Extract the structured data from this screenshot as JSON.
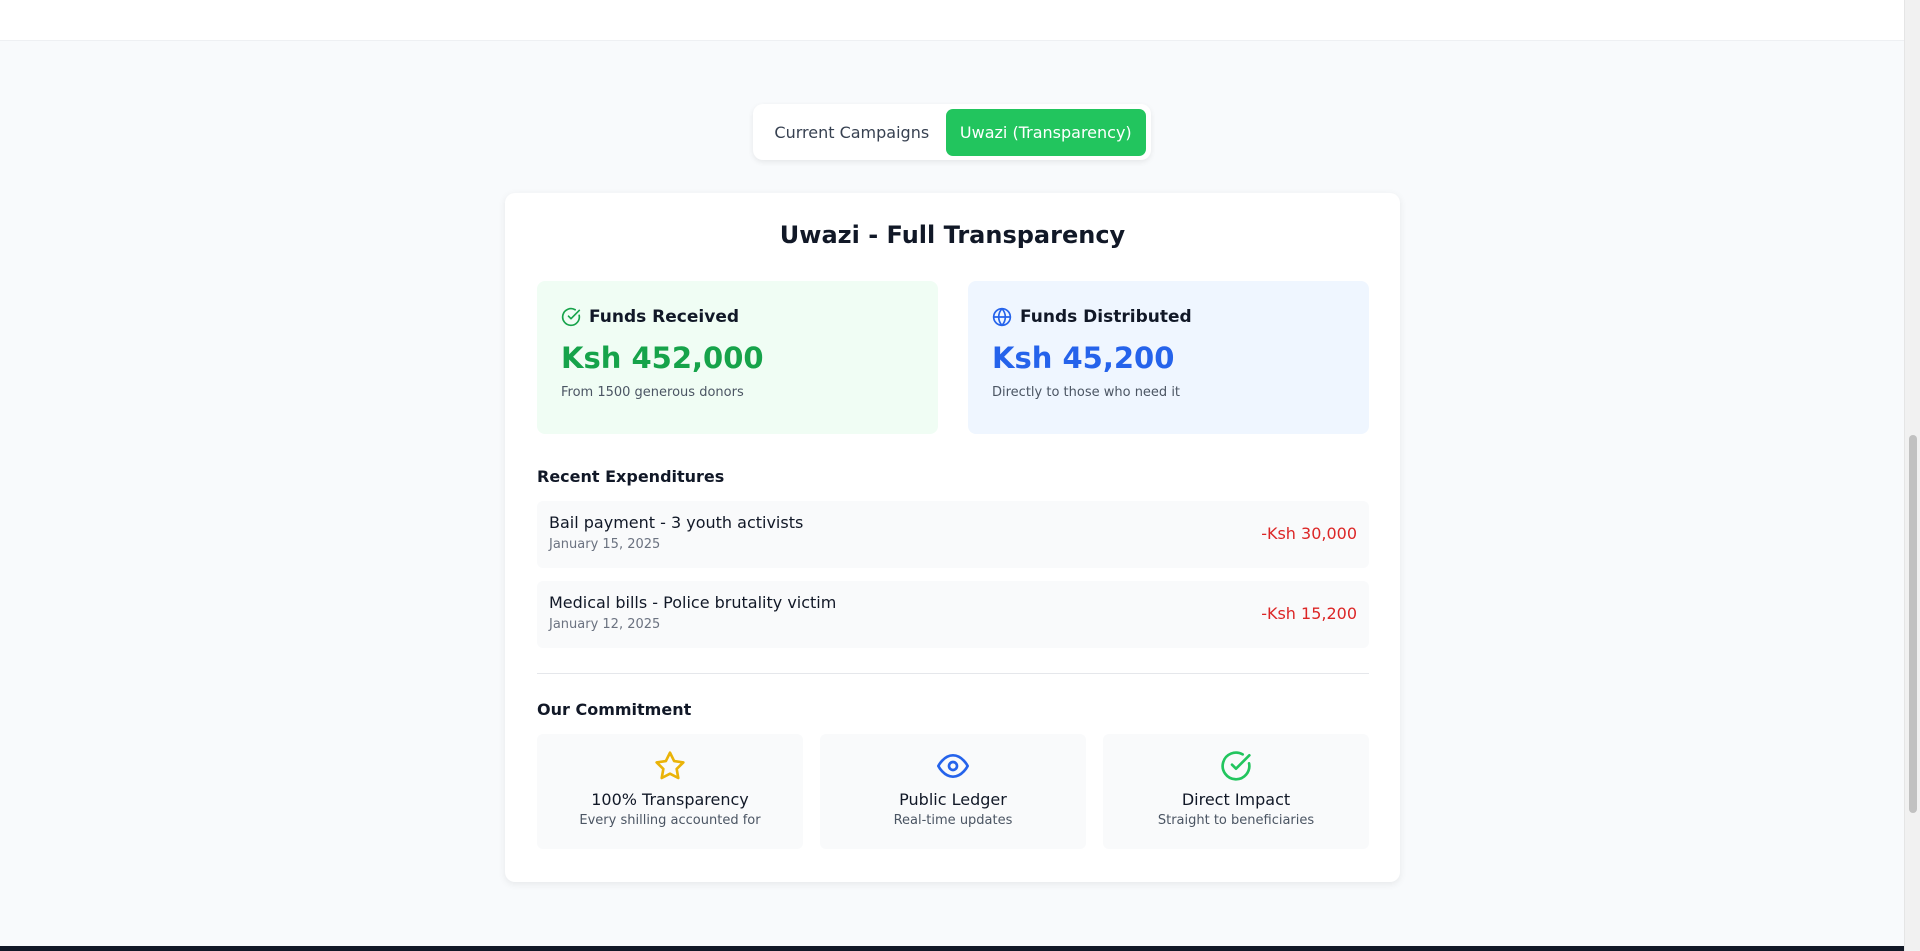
{
  "tabs": {
    "current_campaigns": "Current Campaigns",
    "transparency": "Uwazi (Transparency)"
  },
  "card": {
    "title": "Uwazi - Full Transparency"
  },
  "stats": {
    "received": {
      "label": "Funds Received",
      "amount": "Ksh 452,000",
      "subtitle": "From 1500 generous donors",
      "icon": "check-circle-icon",
      "color": "#16a34a"
    },
    "distributed": {
      "label": "Funds Distributed",
      "amount": "Ksh 45,200",
      "subtitle": "Directly to those who need it",
      "icon": "globe-icon",
      "color": "#2563eb"
    }
  },
  "expenditures": {
    "title": "Recent Expenditures",
    "items": [
      {
        "description": "Bail payment - 3 youth activists",
        "date": "January 15, 2025",
        "amount": "-Ksh 30,000"
      },
      {
        "description": "Medical bills - Police brutality victim",
        "date": "January 12, 2025",
        "amount": "-Ksh 15,200"
      }
    ]
  },
  "commitment": {
    "title": "Our Commitment",
    "items": [
      {
        "title": "100% Transparency",
        "subtitle": "Every shilling accounted for",
        "icon": "star-icon",
        "color": "#eab308"
      },
      {
        "title": "Public Ledger",
        "subtitle": "Real-time updates",
        "icon": "eye-icon",
        "color": "#2563eb"
      },
      {
        "title": "Direct Impact",
        "subtitle": "Straight to beneficiaries",
        "icon": "check-circle-icon",
        "color": "#22c55e"
      }
    ]
  },
  "colors": {
    "accent": "#22c55e",
    "negative": "#dc2626"
  }
}
